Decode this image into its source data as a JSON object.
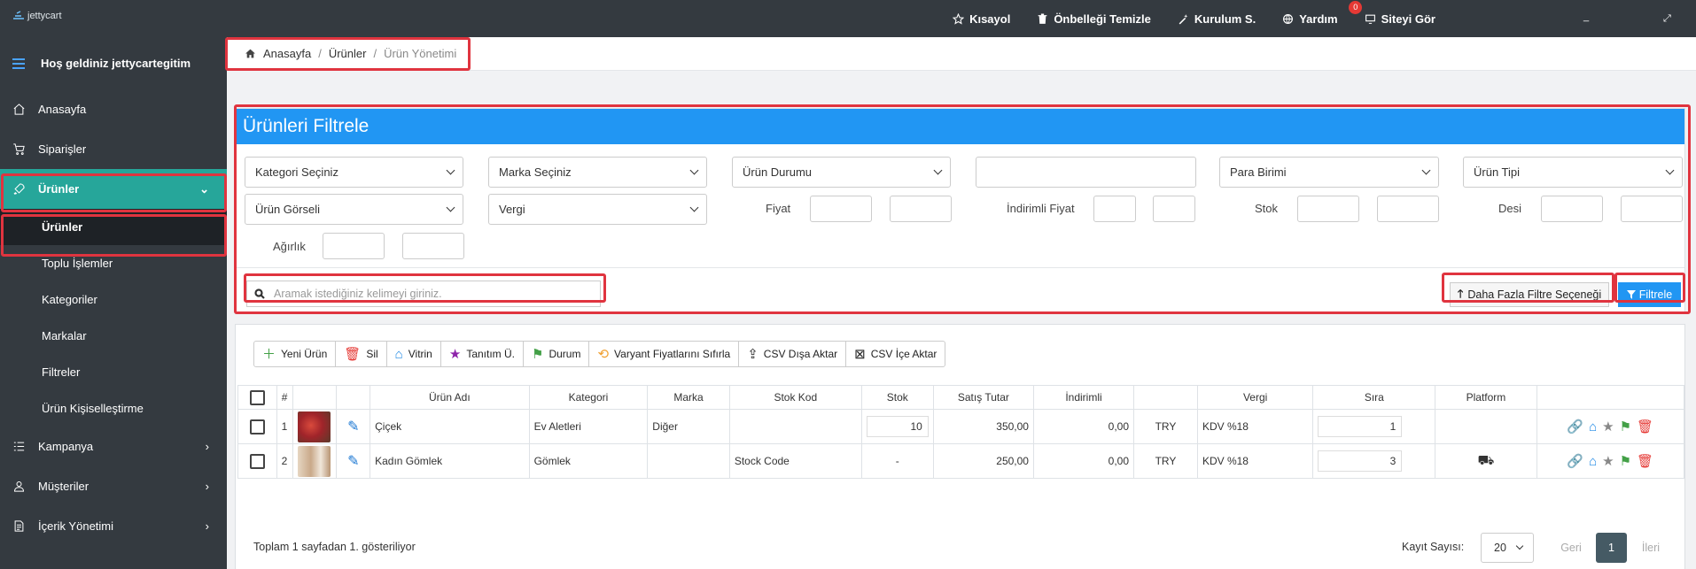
{
  "brand": {
    "logo_text": "jettycart"
  },
  "topnav": {
    "items": [
      {
        "label": "Kısayol",
        "icon": "star-icon"
      },
      {
        "label": "Önbelleği Temizle",
        "icon": "trash-icon"
      },
      {
        "label": "Kurulum S.",
        "icon": "magic-wand-icon"
      },
      {
        "label": "Yardım",
        "icon": "globe-icon",
        "badge": "0"
      },
      {
        "label": "Siteyi Gör",
        "icon": "monitor-icon"
      }
    ],
    "right_mark_1": "_",
    "right_mark_2": "⤢"
  },
  "sidebar": {
    "welcome": "Hoş geldiniz jettycartegitim",
    "items": [
      {
        "label": "Anasayfa",
        "icon": "home-icon"
      },
      {
        "label": "Siparişler",
        "icon": "cart-icon"
      },
      {
        "label": "Ürünler",
        "icon": "rocket-icon",
        "active": true
      },
      {
        "label": "Kampanya",
        "icon": "list-icon"
      },
      {
        "label": "Müşteriler",
        "icon": "user-icon"
      },
      {
        "label": "İçerik Yönetimi",
        "icon": "document-icon"
      }
    ],
    "sub_items": [
      "Ürünler",
      "Toplu İşlemler",
      "Kategoriler",
      "Markalar",
      "Filtreler",
      "Ürün Kişiselleştirme"
    ]
  },
  "breadcrumb": {
    "home": "Anasayfa",
    "level1": "Ürünler",
    "current": "Ürün Yönetimi"
  },
  "filters": {
    "title": "Ürünleri Filtrele",
    "category": "Kategori Seçiniz",
    "brand": "Marka Seçiniz",
    "status": "Ürün Durumu",
    "currency": "Para Birimi",
    "type": "Ürün Tipi",
    "image": "Ürün Görseli",
    "tax": "Vergi",
    "price_label": "Fiyat",
    "discount_price_label": "İndirimli Fiyat",
    "stock_label": "Stok",
    "desi_label": "Desi",
    "weight_label": "Ağırlık",
    "search_placeholder": "Aramak istediğiniz kelimeyi giriniz.",
    "more_button": "Daha Fazla Filtre Seçeneği",
    "filter_button": "Filtrele"
  },
  "toolbar": {
    "new": "Yeni Ürün",
    "delete": "Sil",
    "showcase": "Vitrin",
    "promo": "Tanıtım Ü.",
    "status": "Durum",
    "reset_variant": "Varyant Fiyatlarını Sıfırla",
    "csv_export": "CSV Dışa Aktar",
    "csv_import": "CSV İçe Aktar"
  },
  "table": {
    "headers": {
      "num": "#",
      "name": "Ürün Adı",
      "category": "Kategori",
      "brand": "Marka",
      "stock_code": "Stok Kod",
      "stock": "Stok",
      "price": "Satış Tutar",
      "discount": "İndirimli",
      "tax": "Vergi",
      "order": "Sıra",
      "platform": "Platform"
    },
    "rows": [
      {
        "num": "1",
        "name": "Çiçek",
        "category": "Ev Aletleri",
        "brand": "Diğer",
        "stock_code": "",
        "stock": "10",
        "price": "350,00",
        "discount": "0,00",
        "currency": "TRY",
        "tax": "KDV %18",
        "order": "1",
        "thumb_color": "#b23a2e"
      },
      {
        "num": "2",
        "name": "Kadın Gömlek",
        "category": "Gömlek",
        "brand": "",
        "stock_code": "Stock Code",
        "stock": "-",
        "price": "250,00",
        "discount": "0,00",
        "currency": "TRY",
        "tax": "KDV %18",
        "order": "3",
        "thumb_color": "#c9a98a"
      }
    ]
  },
  "footer": {
    "summary": "Toplam 1 sayfadan 1. gösteriliyor",
    "per_page_label": "Kayıt Sayısı:",
    "per_page_value": "20",
    "prev": "Geri",
    "current_page": "1",
    "next": "İleri"
  },
  "colors": {
    "primary": "#2196f3",
    "sidebar": "#343a40",
    "active": "#26a69a",
    "highlight": "#e0343f"
  }
}
